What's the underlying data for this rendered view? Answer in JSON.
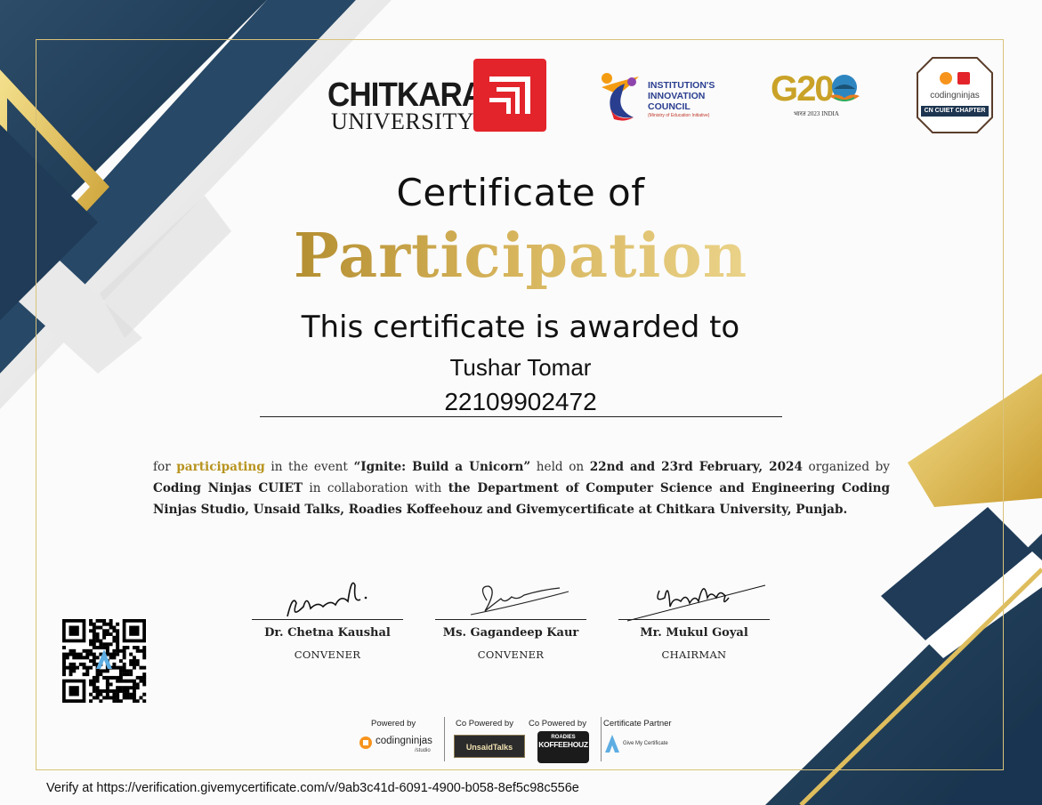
{
  "logos": {
    "chitkara_name": "CHITKARA",
    "chitkara_sub": "UNIVERSITY",
    "iic_lines": [
      "INSTITUTION'S",
      "INNOVATION",
      "COUNCIL"
    ],
    "iic_sub": "(Ministry of Education Initiative)",
    "g20_text": "G20",
    "g20_sub": "भारत 2023 INDIA",
    "cn_word": "codingninjas",
    "cn_chapter": "CN CUIET CHAPTER"
  },
  "certificate": {
    "heading": "Certificate of",
    "title": "Participation",
    "awarded_line": "This certificate is awarded to",
    "recipient_name": "Tushar Tomar",
    "recipient_id": "22109902472"
  },
  "description": {
    "p1": "for ",
    "p2": "participating",
    "p3": " in the event ",
    "p4": "“Ignite: Build a Unicorn”",
    "p5": " held on ",
    "p6": "22nd and 23rd February, 2024",
    "p7": " organized by ",
    "p8": "Coding Ninjas CUIET",
    "p9": " in collaboration with ",
    "p10": "the Department of Computer Science and Engineering Coding Ninjas Studio, Unsaid Talks, Roadies Koffeehouz and Givemycertificate at Chitkara University, Punjab."
  },
  "signatories": [
    {
      "name": "Dr. Chetna Kaushal",
      "role": "CONVENER",
      "signature": "Kaushal"
    },
    {
      "name": "Ms. Gagandeep Kaur",
      "role": "CONVENER",
      "signature": "Gau"
    },
    {
      "name": "Mr. Mukul Goyal",
      "role": "CHAIRMAN",
      "signature": "Mukul Goyal"
    }
  ],
  "partners": {
    "powered_by_label": "Powered by",
    "powered_by_name": "codingninjas",
    "powered_by_sub": "/studio",
    "co_powered_label_1": "Co Powered by",
    "co_powered_name_1": "UnsaidTalks",
    "co_powered_label_2": "Co Powered by",
    "co_powered_name_2_line1": "ROADIES",
    "co_powered_name_2_line2": "KOFFEEHOUZ",
    "certificate_partner_label": "Certificate Partner",
    "certificate_partner_name": "Give My Certificate"
  },
  "verification": {
    "text": "Verify at https://verification.givemycertificate.com/v/9ab3c41d-6091-4900-b058-8ef5c98c556e"
  },
  "colors": {
    "navy": "#1d3550",
    "gold": "#c9a227",
    "red": "#e3242b"
  }
}
